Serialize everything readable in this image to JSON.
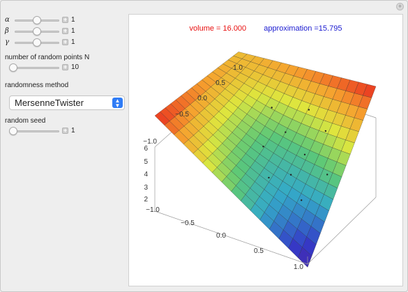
{
  "controls": {
    "alpha": {
      "symbol": "α",
      "value": "1",
      "fraction": 0.5
    },
    "beta": {
      "symbol": "β",
      "value": "1",
      "fraction": 0.5
    },
    "gamma": {
      "symbol": "γ",
      "value": "1",
      "fraction": 0.5
    },
    "n_label": "number of random points N",
    "n": {
      "value": "10",
      "fraction": 0.0
    },
    "method_label": "randomness method",
    "method_value": "MersenneTwister",
    "seed_label": "random seed",
    "seed": {
      "value": "1",
      "fraction": 0.0
    }
  },
  "plot": {
    "volume_text": "volume = 16.000",
    "approximation_text": "approximation =15.795",
    "colors": {
      "volume": "#e81010",
      "approximation": "#1a1ad0"
    },
    "y_ticks": [
      "1.0",
      "0.5",
      "0.0",
      "−0.5",
      "−1.0"
    ],
    "z_ticks": [
      "6",
      "5",
      "4",
      "3",
      "2"
    ],
    "x_ticks": [
      "−1.0",
      "−0.5",
      "0.0",
      "0.5",
      "1.0"
    ],
    "surface_colormap": "rainbow",
    "random_points_count": 10
  }
}
